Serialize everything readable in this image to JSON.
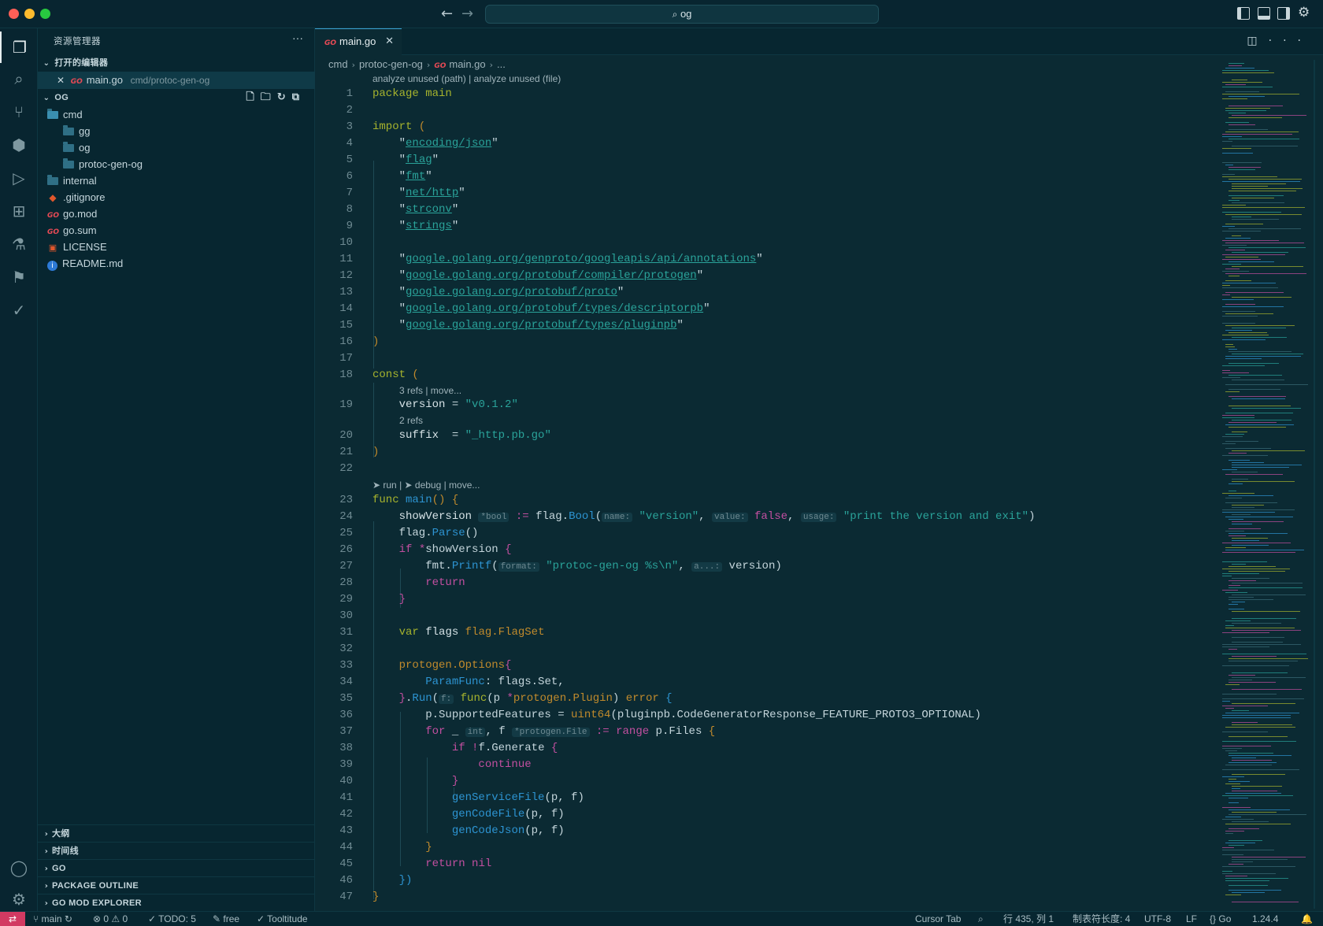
{
  "titlebar": {
    "search_text": "og",
    "search_icon": "search-icon"
  },
  "activity": {
    "items": [
      "explorer-icon",
      "search-icon",
      "source-control-icon",
      "packages-icon",
      "run-debug-icon",
      "extensions-icon",
      "testing-icon",
      "bookmarks-icon",
      "check-icon"
    ],
    "bottom": [
      "account-icon",
      "settings-gear-icon"
    ]
  },
  "sidebar": {
    "title": "资源管理器",
    "open_editors_label": "打开的编辑器",
    "open_editor_file": "main.go",
    "open_editor_path": "cmd/protoc-gen-og",
    "workspace_label": "OG",
    "tree": [
      {
        "name": "cmd",
        "kind": "folder"
      },
      {
        "name": "gg",
        "kind": "folder"
      },
      {
        "name": "og",
        "kind": "folder"
      },
      {
        "name": "protoc-gen-og",
        "kind": "folder"
      },
      {
        "name": "internal",
        "kind": "folder"
      },
      {
        "name": ".gitignore",
        "kind": "git"
      },
      {
        "name": "go.mod",
        "kind": "go"
      },
      {
        "name": "go.sum",
        "kind": "go"
      },
      {
        "name": "LICENSE",
        "kind": "license"
      },
      {
        "name": "README.md",
        "kind": "info"
      }
    ],
    "bottom_sections": [
      "大纲",
      "时间线",
      "GO",
      "PACKAGE OUTLINE",
      "GO MOD EXPLORER"
    ]
  },
  "editor": {
    "tab_label": "main.go",
    "go_glyph": "GO",
    "breadcrumb": [
      "cmd",
      "protoc-gen-og",
      "main.go",
      "..."
    ],
    "lens_top": "analyze unused (path) | analyze unused (file)",
    "lens_const": "3 refs | move...",
    "lens_suffix": "2 refs",
    "lens_main": "➤ run | ➤ debug | move..."
  },
  "status": {
    "branch": "main",
    "problems": "⊗ 0 ⚠ 0",
    "todo": "✓ TODO: 5",
    "free": "free",
    "tooltitude": "✓ Tooltitude",
    "cursor_tab": "Cursor Tab",
    "position": "行 435, 列 1",
    "tab_size": "制表符长度: 4",
    "encoding": "UTF-8",
    "eol": "LF",
    "language": "Go",
    "version": "1.24.4"
  },
  "colors": {
    "background": "#0b2a33",
    "accent": "#3a9fd0",
    "remote": "#d23a62"
  }
}
